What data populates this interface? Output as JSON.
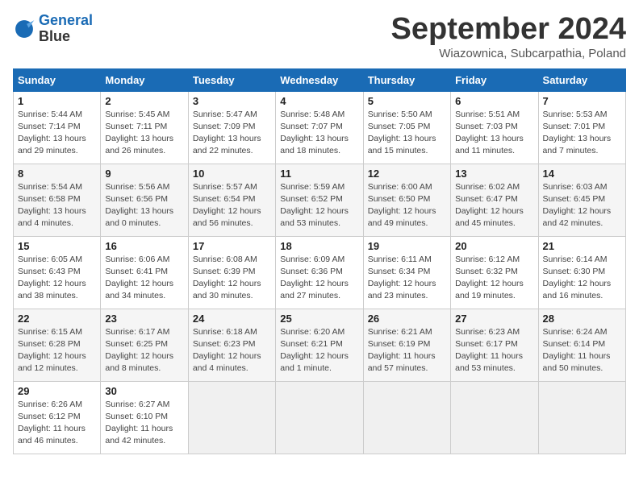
{
  "header": {
    "logo_line1": "General",
    "logo_line2": "Blue",
    "month_title": "September 2024",
    "location": "Wiazownica, Subcarpathia, Poland"
  },
  "weekdays": [
    "Sunday",
    "Monday",
    "Tuesday",
    "Wednesday",
    "Thursday",
    "Friday",
    "Saturday"
  ],
  "weeks": [
    [
      {
        "day": "1",
        "info": "Sunrise: 5:44 AM\nSunset: 7:14 PM\nDaylight: 13 hours\nand 29 minutes."
      },
      {
        "day": "2",
        "info": "Sunrise: 5:45 AM\nSunset: 7:11 PM\nDaylight: 13 hours\nand 26 minutes."
      },
      {
        "day": "3",
        "info": "Sunrise: 5:47 AM\nSunset: 7:09 PM\nDaylight: 13 hours\nand 22 minutes."
      },
      {
        "day": "4",
        "info": "Sunrise: 5:48 AM\nSunset: 7:07 PM\nDaylight: 13 hours\nand 18 minutes."
      },
      {
        "day": "5",
        "info": "Sunrise: 5:50 AM\nSunset: 7:05 PM\nDaylight: 13 hours\nand 15 minutes."
      },
      {
        "day": "6",
        "info": "Sunrise: 5:51 AM\nSunset: 7:03 PM\nDaylight: 13 hours\nand 11 minutes."
      },
      {
        "day": "7",
        "info": "Sunrise: 5:53 AM\nSunset: 7:01 PM\nDaylight: 13 hours\nand 7 minutes."
      }
    ],
    [
      {
        "day": "8",
        "info": "Sunrise: 5:54 AM\nSunset: 6:58 PM\nDaylight: 13 hours\nand 4 minutes."
      },
      {
        "day": "9",
        "info": "Sunrise: 5:56 AM\nSunset: 6:56 PM\nDaylight: 13 hours\nand 0 minutes."
      },
      {
        "day": "10",
        "info": "Sunrise: 5:57 AM\nSunset: 6:54 PM\nDaylight: 12 hours\nand 56 minutes."
      },
      {
        "day": "11",
        "info": "Sunrise: 5:59 AM\nSunset: 6:52 PM\nDaylight: 12 hours\nand 53 minutes."
      },
      {
        "day": "12",
        "info": "Sunrise: 6:00 AM\nSunset: 6:50 PM\nDaylight: 12 hours\nand 49 minutes."
      },
      {
        "day": "13",
        "info": "Sunrise: 6:02 AM\nSunset: 6:47 PM\nDaylight: 12 hours\nand 45 minutes."
      },
      {
        "day": "14",
        "info": "Sunrise: 6:03 AM\nSunset: 6:45 PM\nDaylight: 12 hours\nand 42 minutes."
      }
    ],
    [
      {
        "day": "15",
        "info": "Sunrise: 6:05 AM\nSunset: 6:43 PM\nDaylight: 12 hours\nand 38 minutes."
      },
      {
        "day": "16",
        "info": "Sunrise: 6:06 AM\nSunset: 6:41 PM\nDaylight: 12 hours\nand 34 minutes."
      },
      {
        "day": "17",
        "info": "Sunrise: 6:08 AM\nSunset: 6:39 PM\nDaylight: 12 hours\nand 30 minutes."
      },
      {
        "day": "18",
        "info": "Sunrise: 6:09 AM\nSunset: 6:36 PM\nDaylight: 12 hours\nand 27 minutes."
      },
      {
        "day": "19",
        "info": "Sunrise: 6:11 AM\nSunset: 6:34 PM\nDaylight: 12 hours\nand 23 minutes."
      },
      {
        "day": "20",
        "info": "Sunrise: 6:12 AM\nSunset: 6:32 PM\nDaylight: 12 hours\nand 19 minutes."
      },
      {
        "day": "21",
        "info": "Sunrise: 6:14 AM\nSunset: 6:30 PM\nDaylight: 12 hours\nand 16 minutes."
      }
    ],
    [
      {
        "day": "22",
        "info": "Sunrise: 6:15 AM\nSunset: 6:28 PM\nDaylight: 12 hours\nand 12 minutes."
      },
      {
        "day": "23",
        "info": "Sunrise: 6:17 AM\nSunset: 6:25 PM\nDaylight: 12 hours\nand 8 minutes."
      },
      {
        "day": "24",
        "info": "Sunrise: 6:18 AM\nSunset: 6:23 PM\nDaylight: 12 hours\nand 4 minutes."
      },
      {
        "day": "25",
        "info": "Sunrise: 6:20 AM\nSunset: 6:21 PM\nDaylight: 12 hours\nand 1 minute."
      },
      {
        "day": "26",
        "info": "Sunrise: 6:21 AM\nSunset: 6:19 PM\nDaylight: 11 hours\nand 57 minutes."
      },
      {
        "day": "27",
        "info": "Sunrise: 6:23 AM\nSunset: 6:17 PM\nDaylight: 11 hours\nand 53 minutes."
      },
      {
        "day": "28",
        "info": "Sunrise: 6:24 AM\nSunset: 6:14 PM\nDaylight: 11 hours\nand 50 minutes."
      }
    ],
    [
      {
        "day": "29",
        "info": "Sunrise: 6:26 AM\nSunset: 6:12 PM\nDaylight: 11 hours\nand 46 minutes."
      },
      {
        "day": "30",
        "info": "Sunrise: 6:27 AM\nSunset: 6:10 PM\nDaylight: 11 hours\nand 42 minutes."
      },
      {
        "day": "",
        "info": ""
      },
      {
        "day": "",
        "info": ""
      },
      {
        "day": "",
        "info": ""
      },
      {
        "day": "",
        "info": ""
      },
      {
        "day": "",
        "info": ""
      }
    ]
  ]
}
